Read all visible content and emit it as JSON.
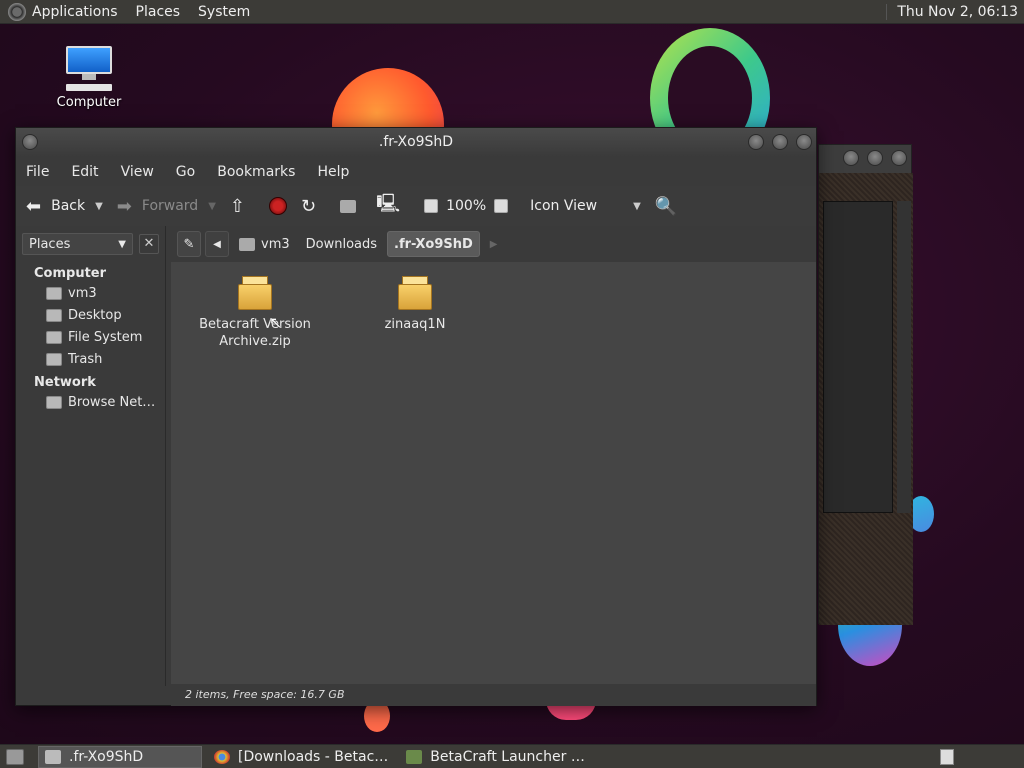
{
  "top_panel": {
    "menus": [
      "Applications",
      "Places",
      "System"
    ],
    "clock": "Thu Nov  2, 06:13"
  },
  "desktop": {
    "computer_icon_label": "Computer"
  },
  "window": {
    "title": ".fr-Xo9ShD",
    "menus": [
      "File",
      "Edit",
      "View",
      "Go",
      "Bookmarks",
      "Help"
    ],
    "toolbar": {
      "back": "Back",
      "forward": "Forward",
      "zoom": "100%",
      "view_mode": "Icon View"
    },
    "sidebar": {
      "selector": "Places",
      "sections": [
        {
          "title": "Computer",
          "items": [
            "vm3",
            "Desktop",
            "File System",
            "Trash"
          ]
        },
        {
          "title": "Network",
          "items": [
            "Browse Net…"
          ]
        }
      ]
    },
    "path": [
      "vm3",
      "Downloads",
      ".fr-Xo9ShD"
    ],
    "files": [
      {
        "name": "Betacraft Version Archive.zip",
        "icon": "package-icon"
      },
      {
        "name": "zinaaq1N",
        "icon": "package-icon"
      }
    ],
    "status": "2 items, Free space: 16.7 GB"
  },
  "taskbar": {
    "tasks": [
      ".fr-Xo9ShD",
      "[Downloads - Betac…",
      "BetaCraft Launcher …"
    ]
  }
}
